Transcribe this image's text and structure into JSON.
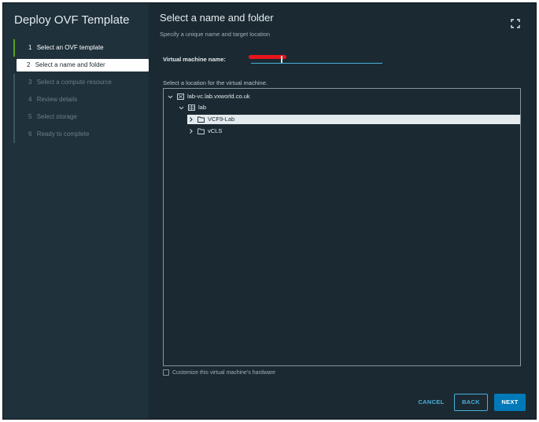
{
  "dialog": {
    "title": "Deploy OVF Template"
  },
  "steps": [
    {
      "num": "1",
      "label": "Select an OVF template",
      "state": "done"
    },
    {
      "num": "2",
      "label": "Select a name and folder",
      "state": "active"
    },
    {
      "num": "3",
      "label": "Select a compute resource",
      "state": "pending"
    },
    {
      "num": "4",
      "label": "Review details",
      "state": "pending"
    },
    {
      "num": "5",
      "label": "Select storage",
      "state": "pending"
    },
    {
      "num": "6",
      "label": "Ready to complete",
      "state": "pending"
    }
  ],
  "page": {
    "title": "Select a name and folder",
    "subtitle": "Specify a unique name and target location"
  },
  "vm_name": {
    "label": "Virtual machine name:",
    "value": "",
    "redacted": true
  },
  "location": {
    "label": "Select a location for the virtual machine.",
    "tree": [
      {
        "label": "lab-vc.lab.vxworld.co.uk",
        "icon": "vcenter-icon",
        "expanded": true,
        "selected": false
      },
      {
        "label": "lab",
        "icon": "datacenter-icon",
        "expanded": true,
        "selected": false
      },
      {
        "label": "VCF9-Lab",
        "icon": "folder-icon",
        "expanded": false,
        "selected": true
      },
      {
        "label": "vCLS",
        "icon": "folder-icon",
        "expanded": false,
        "selected": false
      }
    ]
  },
  "customize": {
    "label": "Customize this virtual machine's hardware",
    "checked": false
  },
  "buttons": {
    "cancel": "CANCEL",
    "back": "BACK",
    "next": "NEXT"
  },
  "colors": {
    "background": "#1b2a32",
    "sidebar": "#1f313b",
    "accent": "#49afd9",
    "primary_button": "#0079b8",
    "done_step": "#5aa220"
  }
}
